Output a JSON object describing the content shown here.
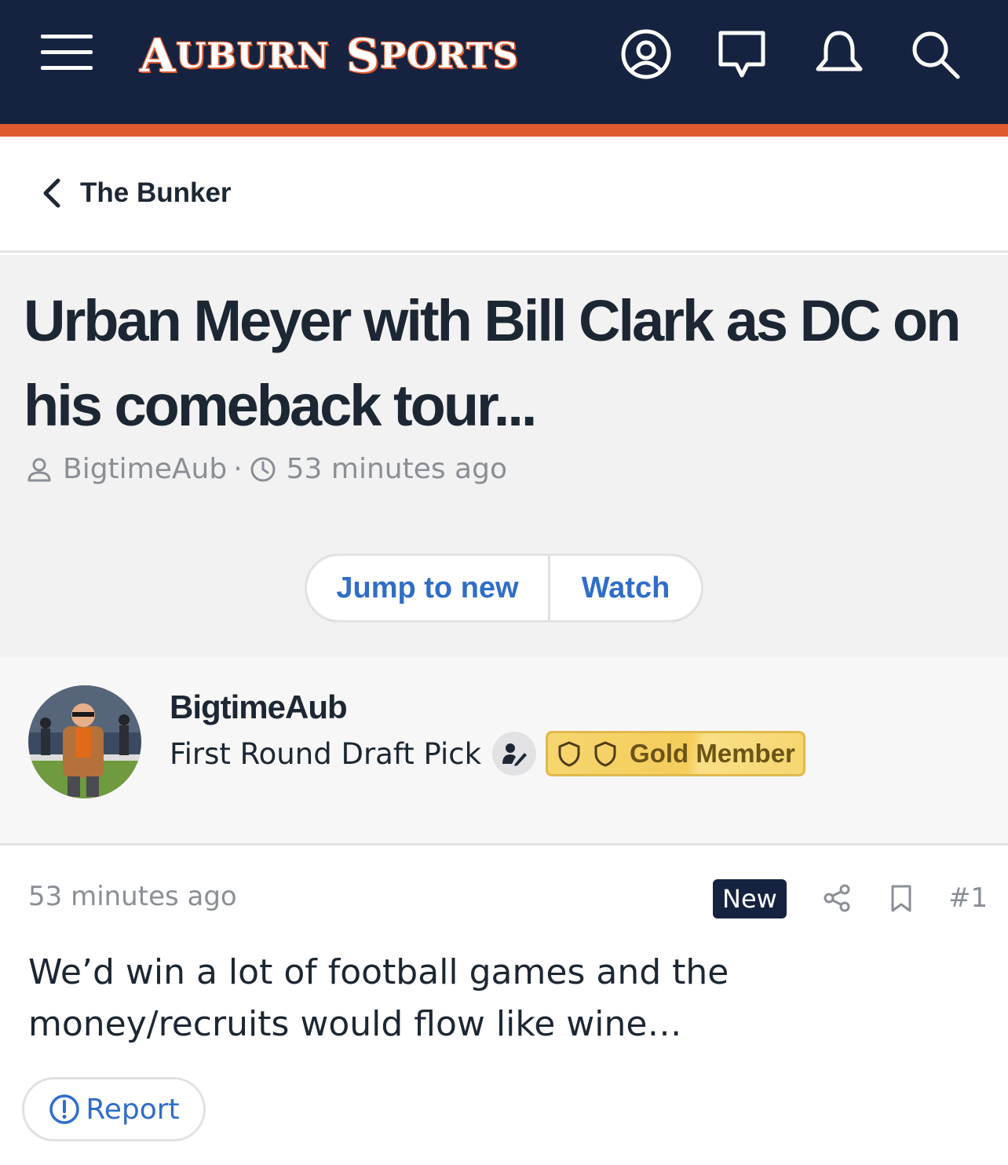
{
  "header": {
    "logo_text_first": "A",
    "logo_text_first_rest": "UBURN",
    "logo_text_second": "S",
    "logo_text_second_rest": "PORTS",
    "colors": {
      "nav_bg": "#152340",
      "accent": "#e05a2f",
      "link": "#2f6dc8"
    },
    "icons": [
      "menu-icon",
      "account-icon",
      "messages-icon",
      "notifications-icon",
      "search-icon"
    ]
  },
  "breadcrumb": {
    "label": "The Bunker"
  },
  "thread": {
    "title": "Urban Meyer with Bill Clark as DC on his comeback tour...",
    "author": "BigtimeAub",
    "separator": "·",
    "time": "53 minutes ago",
    "actions": {
      "jump_label": "Jump to new",
      "watch_label": "Watch"
    }
  },
  "author_block": {
    "name": "BigtimeAub",
    "rank": "First Round Draft Pick",
    "badge_label": "Gold Member"
  },
  "post": {
    "time": "53 minutes ago",
    "new_label": "New",
    "number": "#1",
    "body": "We’d win a lot of football games and the money/recruits would flow like wine…",
    "report_label": "Report"
  }
}
